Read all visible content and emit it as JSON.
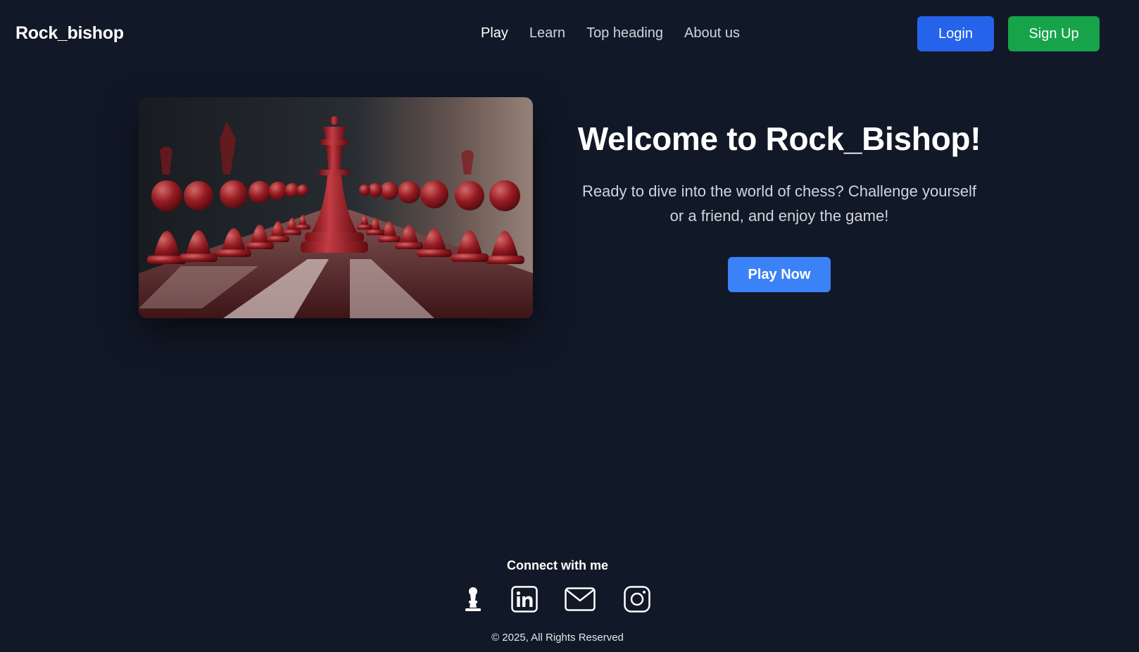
{
  "header": {
    "brand": "Rock_bishop",
    "nav": [
      {
        "label": "Play"
      },
      {
        "label": "Learn"
      },
      {
        "label": "Top heading"
      },
      {
        "label": "About us"
      }
    ],
    "login_label": "Login",
    "signup_label": "Sign Up"
  },
  "hero": {
    "title": "Welcome to Rock_Bishop!",
    "subtitle": "Ready to dive into the world of chess? Challenge yourself or a friend, and enjoy the game!",
    "play_label": "Play Now"
  },
  "footer": {
    "heading": "Connect with me",
    "socials": [
      {
        "icon": "chess-pawn-icon"
      },
      {
        "icon": "linkedin-icon"
      },
      {
        "icon": "mail-icon"
      },
      {
        "icon": "instagram-icon"
      }
    ],
    "copyright": "© 2025, All Rights Reserved"
  },
  "colors": {
    "background": "#111827",
    "login": "#2563eb",
    "signup": "#16a34a",
    "play": "#3b82f6"
  }
}
